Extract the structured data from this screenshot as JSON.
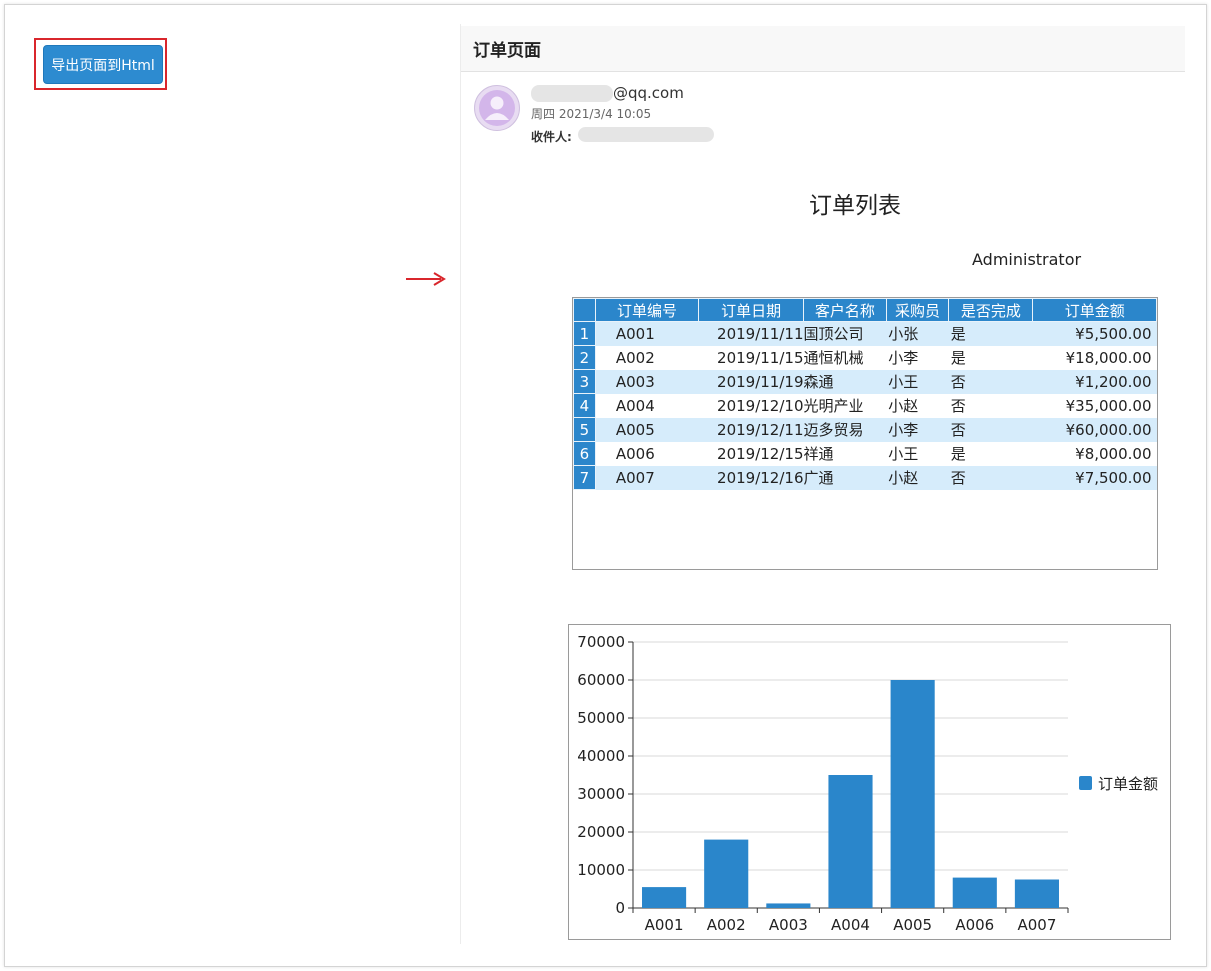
{
  "toolbar": {
    "export_label": "导出页面到Html"
  },
  "email": {
    "header_title": "订单页面",
    "sender_domain": "@qq.com",
    "date": "周四 2021/3/4 10:05",
    "recipient_label": "收件人:"
  },
  "report": {
    "title": "订单列表",
    "user": "Administrator"
  },
  "table": {
    "headers": [
      "订单编号",
      "订单日期",
      "客户名称",
      "采购员",
      "是否完成",
      "订单金额"
    ],
    "rows": [
      {
        "index": "1",
        "id": "A001",
        "date": "2019/11/11",
        "customer": "国顶公司",
        "buyer": "小张",
        "done": "是",
        "amount": "¥5,500.00"
      },
      {
        "index": "2",
        "id": "A002",
        "date": "2019/11/15",
        "customer": "通恒机械",
        "buyer": "小李",
        "done": "是",
        "amount": "¥18,000.00"
      },
      {
        "index": "3",
        "id": "A003",
        "date": "2019/11/19",
        "customer": "森通",
        "buyer": "小王",
        "done": "否",
        "amount": "¥1,200.00"
      },
      {
        "index": "4",
        "id": "A004",
        "date": "2019/12/10",
        "customer": "光明产业",
        "buyer": "小赵",
        "done": "否",
        "amount": "¥35,000.00"
      },
      {
        "index": "5",
        "id": "A005",
        "date": "2019/12/11",
        "customer": "迈多贸易",
        "buyer": "小李",
        "done": "否",
        "amount": "¥60,000.00"
      },
      {
        "index": "6",
        "id": "A006",
        "date": "2019/12/15",
        "customer": "祥通",
        "buyer": "小王",
        "done": "是",
        "amount": "¥8,000.00"
      },
      {
        "index": "7",
        "id": "A007",
        "date": "2019/12/16",
        "customer": "广通",
        "buyer": "小赵",
        "done": "否",
        "amount": "¥7,500.00"
      }
    ]
  },
  "chart_data": {
    "type": "bar",
    "categories": [
      "A001",
      "A002",
      "A003",
      "A004",
      "A005",
      "A006",
      "A007"
    ],
    "series": [
      {
        "name": "订单金额",
        "values": [
          5500,
          18000,
          1200,
          35000,
          60000,
          8000,
          7500
        ]
      }
    ],
    "ylim": [
      0,
      70000
    ],
    "yticks": [
      0,
      10000,
      20000,
      30000,
      40000,
      50000,
      60000,
      70000
    ],
    "grid": true,
    "legend": "right",
    "color": "#2a86cb"
  },
  "colors": {
    "accent": "#2d8bd0",
    "highlight": "#d9262c",
    "header_blue": "#2b86cb",
    "row_alt": "#d6ecfb"
  },
  "icons": {
    "avatar": "user-avatar-icon",
    "pointer": "arrow-right-icon"
  }
}
